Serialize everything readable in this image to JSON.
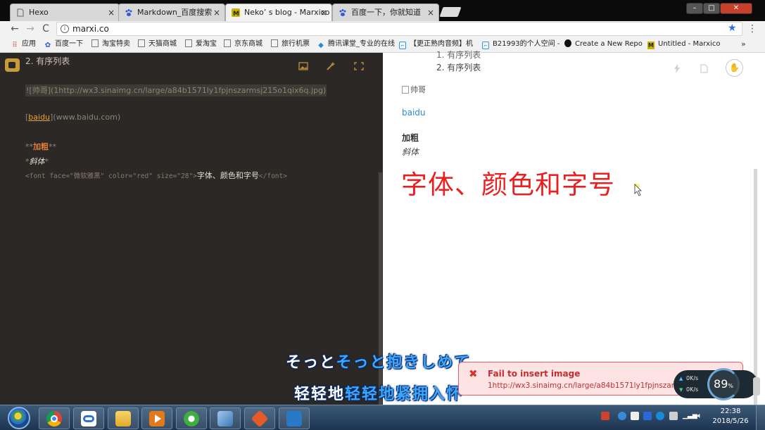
{
  "browser": {
    "tabs": [
      {
        "label": "Hexo",
        "close": "×"
      },
      {
        "label": "Markdown_百度搜索",
        "close": "×"
      },
      {
        "label": "Neko’ s blog - Marxico",
        "close": "×"
      },
      {
        "label": "百度一下，你就知道",
        "close": "×"
      }
    ],
    "window_controls": {
      "minimize": "–",
      "restore": "□",
      "close": "✕"
    },
    "nav": {
      "back": "←",
      "forward": "→",
      "reload": "C"
    },
    "address": "marxi.co",
    "star": "★",
    "menu": "⋮",
    "bookmarks": [
      {
        "label": "应用",
        "icon": "apps-grid-icon"
      },
      {
        "label": "百度一下",
        "icon": "baidu-paw-icon"
      },
      {
        "label": "淘宝特卖",
        "icon": "page-icon"
      },
      {
        "label": "天猫商城",
        "icon": "page-icon"
      },
      {
        "label": "爱淘宝",
        "icon": "page-icon"
      },
      {
        "label": "京东商城",
        "icon": "page-icon"
      },
      {
        "label": "旅行机票",
        "icon": "page-icon"
      },
      {
        "label": "腾讯课堂_专业的在线",
        "icon": "tencent-classroom-icon"
      },
      {
        "label": "【更正熟肉音频】机",
        "icon": "bilibili-icon"
      },
      {
        "label": "B21993的个人空间 -",
        "icon": "bilibili-icon"
      },
      {
        "label": "Create a New Repo",
        "icon": "github-icon"
      },
      {
        "label": "Untitled - Marxico",
        "icon": "marxico-icon"
      }
    ],
    "bookmarks_more": "»"
  },
  "editor": {
    "list_item": "2. 有序列表",
    "image_md": "![帅哥](1http://wx3.sinaimg.cn/large/a84b1571ly1fpjnszarmsj215o1qix6q.jpg)",
    "link_open": "[",
    "link_text": "baidu",
    "link_rest": "](www.baidu.com)",
    "bold_mark_open": "**",
    "bold_text": "加粗",
    "bold_mark_close": "**",
    "italic_mark_open": "*",
    "italic_text": "斜体",
    "italic_mark_close": "*",
    "font_tag_open": "<font face=\"微软雅黑\" color=\"red\" size=\"28\">",
    "font_text": "字体、颜色和字号",
    "font_tag_close": "</font>"
  },
  "preview": {
    "list_item_1": "1. 有序列表",
    "list_item_2": "2. 有序列表",
    "image_alt": "帅哥",
    "link": "baidu",
    "bold": "加粗",
    "italic": "斜体",
    "big_red": "字体、颜色和字号",
    "big_red_color": "#e82020"
  },
  "subtitles": {
    "line1_white": "そっと",
    "line1_blue": "そっと抱きしめて",
    "line2_white": "轻轻地",
    "line2_blue": "轻轻地紧拥入怀"
  },
  "toast": {
    "icon": "✖",
    "title": "Fail to insert image",
    "message": "1http://wx3.sinaimg.cn/large/a84b1571ly1fpjnszarmsj215o1qix6q.jpg"
  },
  "speed_widget": {
    "up": "0K/s",
    "down": "0K/s",
    "percent": "89",
    "percent_sign": "%"
  },
  "taskbar": {
    "time": "22:38",
    "date": "2018/5/26"
  }
}
